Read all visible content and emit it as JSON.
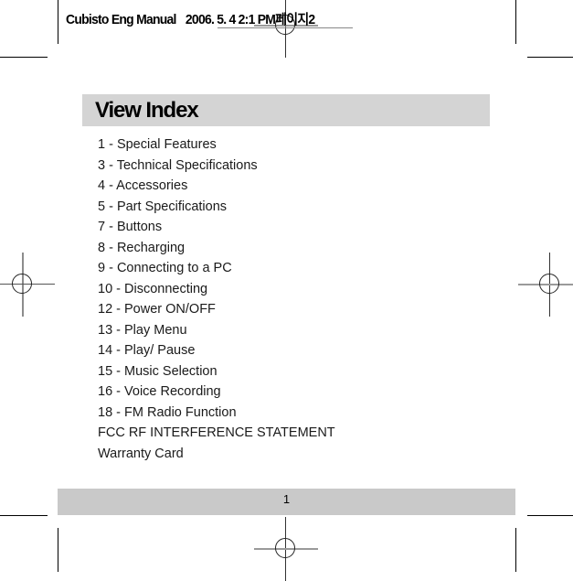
{
  "document": {
    "header": {
      "file_label": "Cubisto Eng Manual",
      "date_label": "2006. 5. 4  2:1  PM페이지2"
    },
    "title": "View Index",
    "index_items": [
      "1 - Special Features",
      "3 - Technical Specifications",
      "4 - Accessories",
      "5 - Part Specifications",
      "7 - Buttons",
      "8 - Recharging",
      "9 - Connecting to a PC",
      "10 - Disconnecting",
      "12 - Power ON/OFF",
      "13 - Play Menu",
      "14 - Play/ Pause",
      "15 - Music Selection",
      "16 - Voice Recording",
      "18 - FM Radio Function",
      "FCC RF INTERFERENCE STATEMENT",
      "Warranty Card"
    ],
    "footer": {
      "page_number": "1"
    },
    "colors": {
      "title_bar_background": "#d4d4d4",
      "footer_bar_background": "#c9c9c9",
      "text": "#000000",
      "crop_mark": "#000000",
      "registration_mark": "#333333"
    }
  }
}
